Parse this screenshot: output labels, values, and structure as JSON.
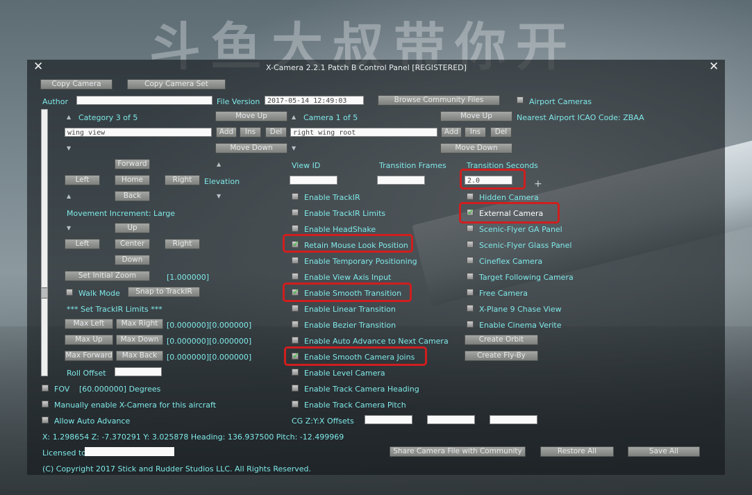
{
  "watermark": "斗鱼大叔带你开",
  "window": {
    "title": "X-Camera 2.2.1 Patch B Control Panel    [REGISTERED]",
    "close_glyph": "✕"
  },
  "toolbar": {
    "copy_camera": "Copy Camera",
    "copy_camera_set": "Copy Camera Set"
  },
  "author": {
    "label": "Author",
    "value": ""
  },
  "file_version": {
    "label": "File Version",
    "value": "2017-05-14 12:49:03"
  },
  "browse_community": "Browse Community Files",
  "airport_cameras": {
    "label": "Airport Cameras",
    "checked": false
  },
  "category": {
    "label": "Category 3 of 5",
    "name": "wing view",
    "move_up": "Move Up",
    "move_down": "Move Down",
    "add": "Add",
    "ins": "Ins",
    "del": "Del"
  },
  "camera": {
    "label": "Camera 1 of 5",
    "name": "right wing root",
    "move_up": "Move Up",
    "move_down": "Move Down",
    "add": "Add",
    "ins": "Ins",
    "del": "Del"
  },
  "nearest_airport": "Nearest Airport ICAO Code: ZBAA",
  "movement": {
    "forward": "Forward",
    "left": "Left",
    "home": "Home",
    "right": "Right",
    "back": "Back",
    "elevation": "Elevation",
    "increment": "Movement Increment: Large",
    "up": "Up",
    "left2": "Left",
    "center": "Center",
    "right2": "Right",
    "down": "Down",
    "set_initial_zoom": "Set Initial Zoom",
    "zoom_value": "[1.000000]",
    "walk_mode": "Walk Mode",
    "snap_trackir": "Snap to TrackIR",
    "trackir_limits": "*** Set TrackIR Limits ***",
    "max_left": "Max Left",
    "max_right": "Max Right",
    "lr_value": "[0.000000][0.000000]",
    "max_up": "Max Up",
    "max_down": "Max Down",
    "ud_value": "[0.000000][0.000000]",
    "max_forward": "Max Forward",
    "max_back": "Max Back",
    "fb_value": "[0.000000][0.000000]",
    "roll_offset": "Roll Offset"
  },
  "fov": {
    "label": "FOV",
    "value": "[60.000000] Degrees"
  },
  "manual_enable": "Manually enable X-Camera for this aircraft",
  "allow_auto_advance": "Allow Auto Advance",
  "fields": {
    "view_id": "View ID",
    "transition_frames": "Transition Frames",
    "transition_seconds": "Transition Seconds",
    "seconds_value": "2.0"
  },
  "mid_options": [
    {
      "label": "Enable TrackIR",
      "checked": false
    },
    {
      "label": "Enable TrackIR Limits",
      "checked": false
    },
    {
      "label": "Enable HeadShake",
      "checked": false
    },
    {
      "label": "Retain Mouse Look Position",
      "checked": true
    },
    {
      "label": "Enable Temporary Positioning",
      "checked": false
    },
    {
      "label": "Enable View Axis Input",
      "checked": false
    },
    {
      "label": "Enable Smooth Transition",
      "checked": true
    },
    {
      "label": "Enable Linear Transition",
      "checked": false
    },
    {
      "label": "Enable Bezier Transition",
      "checked": false
    },
    {
      "label": "Enable Auto Advance to Next Camera",
      "checked": false
    },
    {
      "label": "Enable Smooth Camera Joins",
      "checked": true
    },
    {
      "label": "Enable Level Camera",
      "checked": false
    },
    {
      "label": "Enable Track Camera Heading",
      "checked": false
    },
    {
      "label": "Enable Track Camera Pitch",
      "checked": false
    }
  ],
  "right_options": [
    {
      "label": "Hidden Camera",
      "checked": false
    },
    {
      "label": "External Camera",
      "checked": true
    },
    {
      "label": "Scenic-Flyer GA Panel",
      "checked": false
    },
    {
      "label": "Scenic-Flyer Glass Panel",
      "checked": false
    },
    {
      "label": "Cineflex Camera",
      "checked": false
    },
    {
      "label": "Target Following Camera",
      "checked": false
    },
    {
      "label": "Free Camera",
      "checked": false
    },
    {
      "label": "X-Plane 9 Chase View",
      "checked": false
    },
    {
      "label": "Enable Cinema Verite",
      "checked": false
    }
  ],
  "create_orbit": "Create Orbit",
  "create_flyby": "Create Fly-By",
  "cg_offsets": "CG Z:Y:X Offsets",
  "status_line": "X: 1.298654 Z: -7.370291 Y: 3.025878 Heading: 136.937500 Pitch: -12.499969",
  "licensed_to": "Licensed to",
  "share_camera": "Share Camera File with Community",
  "restore_all": "Restore All",
  "save_all": "Save All",
  "copyright": "(C) Copyright 2017 Stick and Rudder Studios LLC. All Rights Reserved."
}
